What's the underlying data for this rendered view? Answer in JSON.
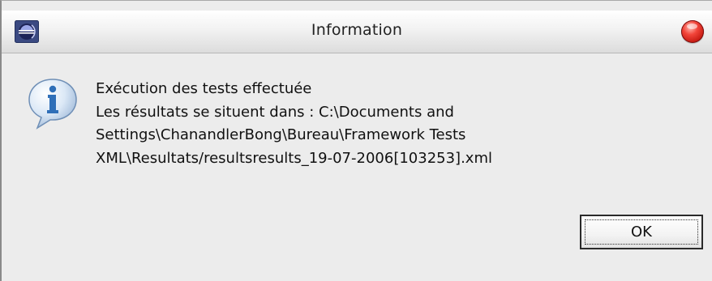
{
  "window": {
    "title": "Information",
    "app_icon": "eclipse-icon",
    "close_icon": "close-icon"
  },
  "dialog": {
    "icon": "info-icon",
    "message_lines": [
      "Exécution des tests effectuée",
      "Les résultats se situent dans : C:\\Documents and",
      "Settings\\ChanandlerBong\\Bureau\\Framework Tests",
      "XML\\Resultats/resultsresults_19-07-2006[103253].xml"
    ],
    "ok_label": "OK"
  },
  "colors": {
    "background": "#ececec",
    "close_button": "#d8261c",
    "info_icon": "#2f6fb8"
  }
}
